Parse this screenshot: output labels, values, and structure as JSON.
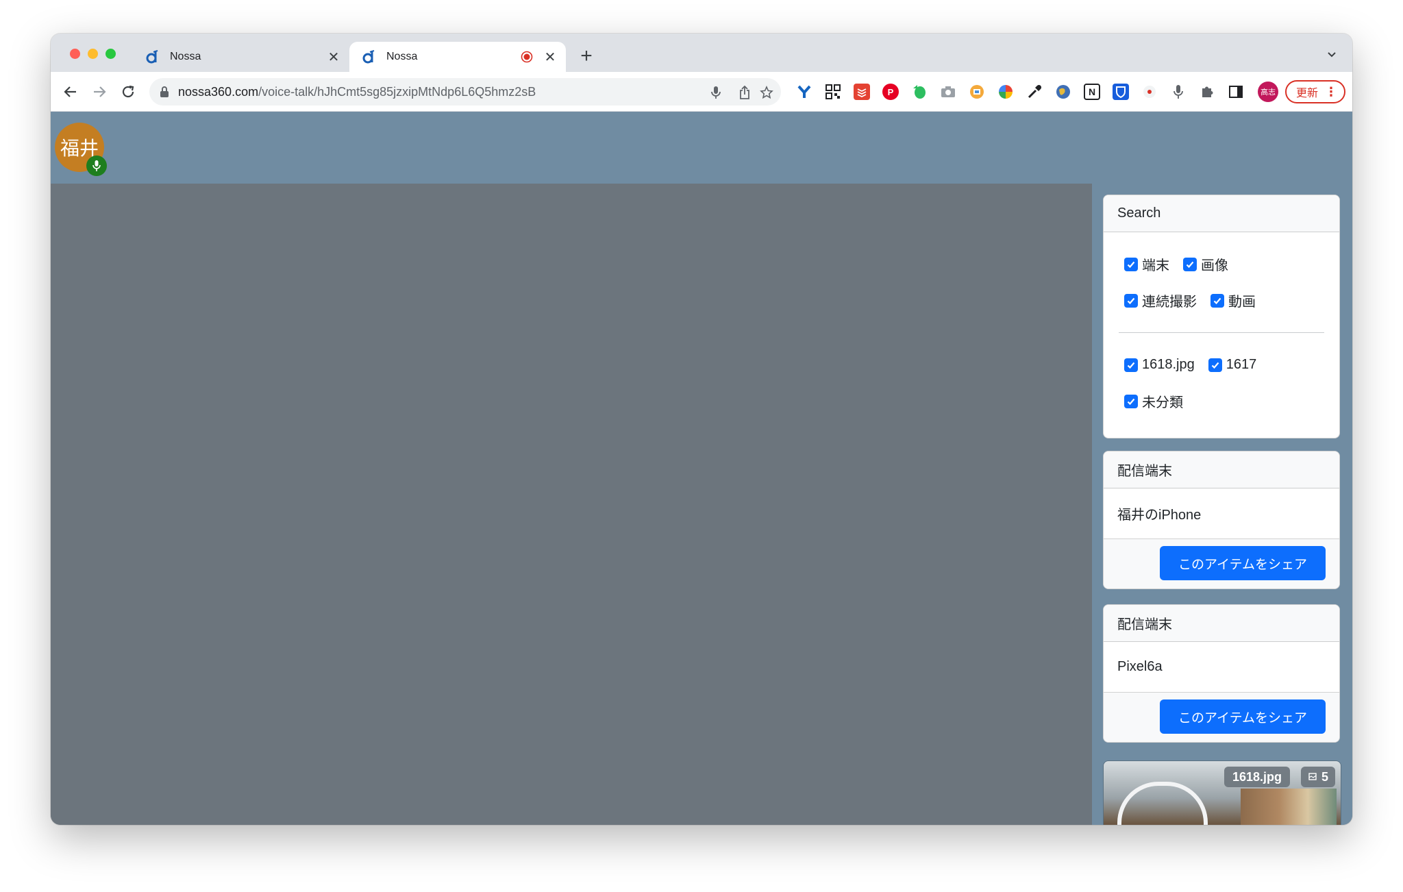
{
  "browser": {
    "tabs": [
      {
        "title": "Nossa",
        "active": false
      },
      {
        "title": "Nossa",
        "active": true,
        "recording": true
      }
    ],
    "address": {
      "host": "nossa360.com",
      "path": "/voice-talk/hJhCmt5sg85jzxipMtNdp6L6Q5hmz2sB"
    },
    "profile_label": "高志",
    "update_label": "更新",
    "colors": {
      "accent": "#0d6efd",
      "header": "#708ca2",
      "stage": "#6c757d"
    }
  },
  "header": {
    "avatar_text": "福井"
  },
  "search": {
    "title": "Search",
    "groups": [
      [
        [
          "端末",
          "画像"
        ],
        [
          "連続撮影",
          "動画"
        ]
      ],
      [
        [
          "1618.jpg",
          "1617"
        ],
        [
          "未分類"
        ]
      ]
    ]
  },
  "devices": [
    {
      "header": "配信端末",
      "name": "福井のiPhone",
      "share_label": "このアイテムをシェア"
    },
    {
      "header": "配信端末",
      "name": "Pixel6a",
      "share_label": "このアイテムをシェア"
    }
  ],
  "thumbnail": {
    "filename": "1618.jpg",
    "count": "5"
  }
}
